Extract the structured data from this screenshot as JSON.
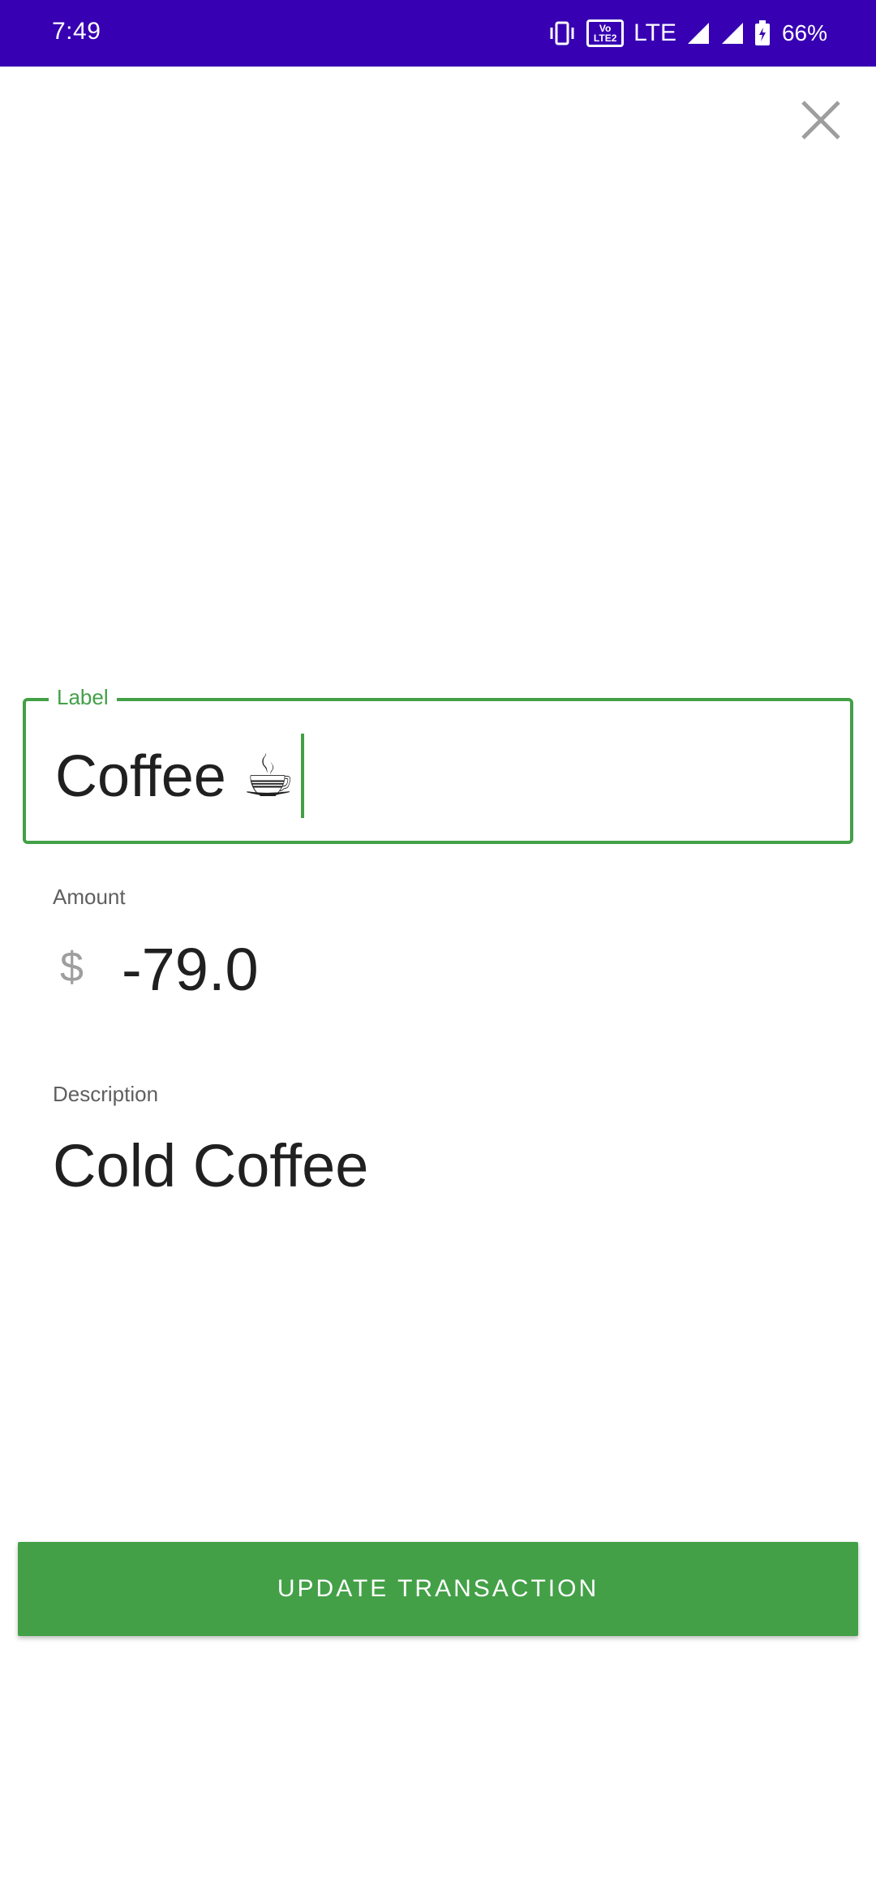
{
  "status_bar": {
    "time": "7:49",
    "network": "LTE",
    "volte_badge": "Vo LTE2",
    "battery": "66%",
    "icons": [
      "vibrate-icon",
      "volte-icon",
      "signal-icon",
      "signal-icon",
      "battery-icon"
    ],
    "background": "#3700b3"
  },
  "form": {
    "close_icon": "close-icon",
    "label_field": {
      "legend": "Label",
      "value": "Coffee ☕"
    },
    "amount": {
      "caption": "Amount",
      "currency": "$",
      "value": "-79.0"
    },
    "description": {
      "caption": "Description",
      "value": "Cold Coffee"
    },
    "submit_label": "UPDATE TRANSACTION"
  },
  "colors": {
    "accent": "#43a047",
    "status_bar": "#3700b3",
    "text": "#202020",
    "caption": "#5f5f5f"
  }
}
